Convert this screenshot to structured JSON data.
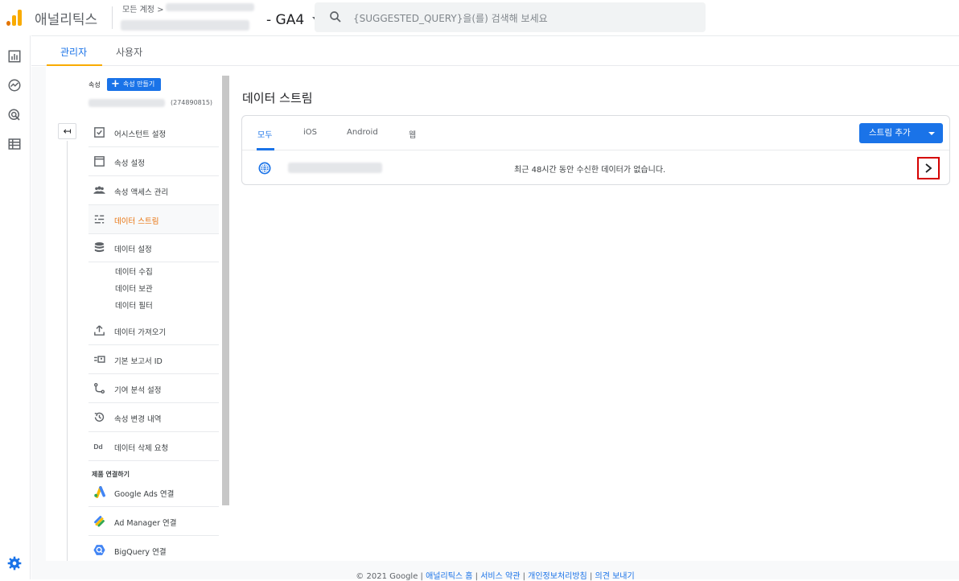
{
  "header": {
    "app_name": "애널리틱스",
    "account_crumb": "모든 계정 >",
    "property_name": "- GA4",
    "search_placeholder": "{SUGGESTED_QUERY}을(를) 검색해 보세요"
  },
  "top_tabs": [
    {
      "label": "관리자",
      "active": true
    },
    {
      "label": "사용자",
      "active": false
    }
  ],
  "property_panel": {
    "label": "속성",
    "create_button": "속성 만들기",
    "property_id": "(274890815)",
    "items": [
      {
        "label": "어시스턴트 설정",
        "icon": "checklist-icon"
      },
      {
        "label": "속성 설정",
        "icon": "window-icon"
      },
      {
        "label": "속성 액세스 관리",
        "icon": "people-icon"
      },
      {
        "label": "데이터 스트림",
        "icon": "streams-icon",
        "active": true
      },
      {
        "label": "데이터 설정",
        "icon": "database-icon"
      },
      {
        "label": "데이터 가져오기",
        "icon": "upload-icon"
      },
      {
        "label": "기본 보고서 ID",
        "icon": "id-icon"
      },
      {
        "label": "기여 분석 설정",
        "icon": "attribution-icon"
      },
      {
        "label": "속성 변경 내역",
        "icon": "history-icon"
      },
      {
        "label": "데이터 삭제 요청",
        "icon": "dd-icon"
      }
    ],
    "sub_items": [
      "데이터 수집",
      "데이터 보관",
      "데이터 필터"
    ],
    "section_title": "제품 연결하기",
    "links": [
      {
        "label": "Google Ads 연결",
        "icon": "google-ads-icon"
      },
      {
        "label": "Ad Manager 연결",
        "icon": "ad-manager-icon"
      },
      {
        "label": "BigQuery 연결",
        "icon": "bigquery-icon"
      }
    ]
  },
  "content": {
    "title": "데이터 스트림",
    "filter_tabs": [
      {
        "label": "모두",
        "active": true
      },
      {
        "label": "iOS",
        "active": false
      },
      {
        "label": "Android",
        "active": false
      },
      {
        "label": "웹",
        "active": false
      }
    ],
    "add_stream_button": "스트림 추가",
    "stream": {
      "status": "최근 48시간 동안 수신한 데이터가 없습니다."
    }
  },
  "footer": {
    "copyright": "© 2021 Google |",
    "links": [
      "애널리틱스 홈",
      "서비스 약관",
      "개인정보처리방침",
      "의견 보내기"
    ],
    "separator": " | "
  },
  "colors": {
    "accent": "#1a73e8",
    "active_nav": "#e8710a",
    "tab_underline": "#f9ab00",
    "highlight_border": "#d50000"
  }
}
